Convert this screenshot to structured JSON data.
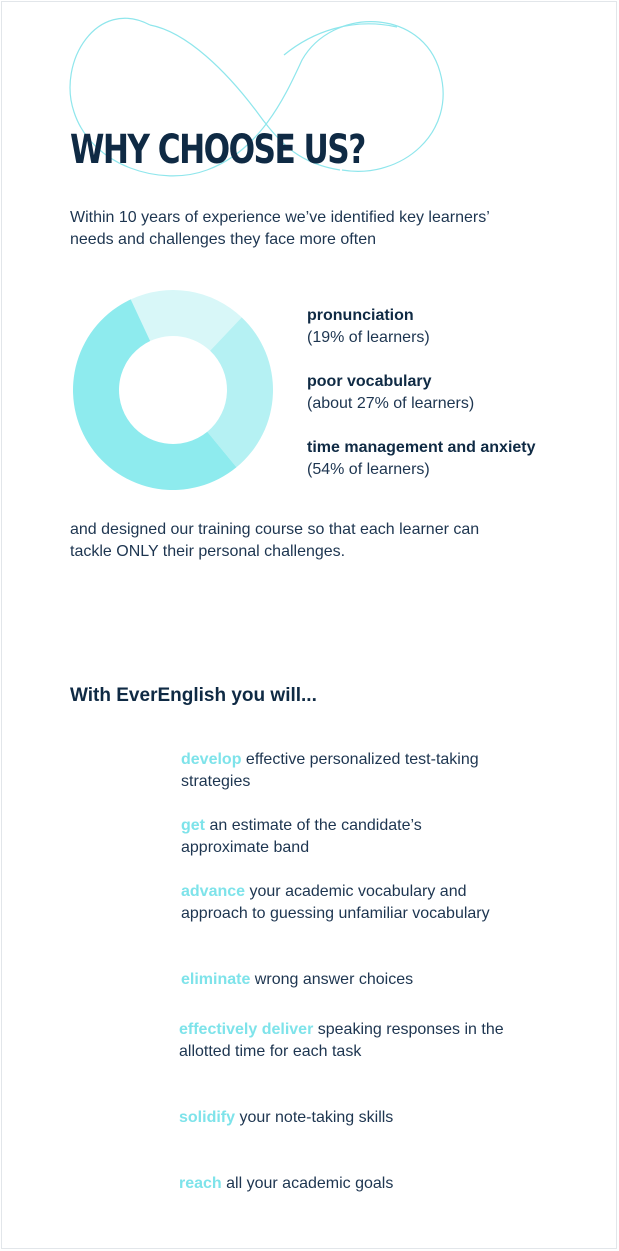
{
  "header": {
    "title": "WHY CHOOSE US?"
  },
  "intro": {
    "text": "Within 10 years of experience we’ve identified key learners’ needs and challenges they face more often"
  },
  "chart_data": {
    "type": "pie",
    "categories": [
      "pronunciation",
      "poor vocabulary",
      "time management and anxiety"
    ],
    "values": [
      19,
      27,
      54
    ],
    "colors": [
      "#d8f7f8",
      "#b5f1f3",
      "#8eebee"
    ],
    "title": "",
    "legend": [
      {
        "label": "pronunciation",
        "detail": "(19% of learners)"
      },
      {
        "label": "poor vocabulary",
        "detail": "(about 27% of learners)"
      },
      {
        "label": "time management and anxiety",
        "detail": "(54% of learners)"
      }
    ]
  },
  "outro": {
    "text": "and designed our training course so that each learner can tackle ONLY their personal challenges."
  },
  "benefits": {
    "heading": "With EverEnglish you will...",
    "items": [
      {
        "keyword": "develop",
        "text": " effective personalized test-taking strategies"
      },
      {
        "keyword": "get",
        "text": " an estimate of the candidate’s approximate band"
      },
      {
        "keyword": "advance",
        "text": " your academic vocabulary and approach to guessing unfamiliar vocabulary"
      },
      {
        "keyword": "eliminate",
        "text": " wrong answer choices"
      },
      {
        "keyword": "effectively deliver",
        "text": " speaking responses in the allotted time for each task"
      },
      {
        "keyword": "solidify",
        "text": " your note-taking skills"
      },
      {
        "keyword": "reach",
        "text": " all your academic goals"
      }
    ]
  },
  "colors": {
    "accent": "#7ee3ea",
    "heading": "#0f2a44",
    "deco_line": "#8fe6ec"
  }
}
